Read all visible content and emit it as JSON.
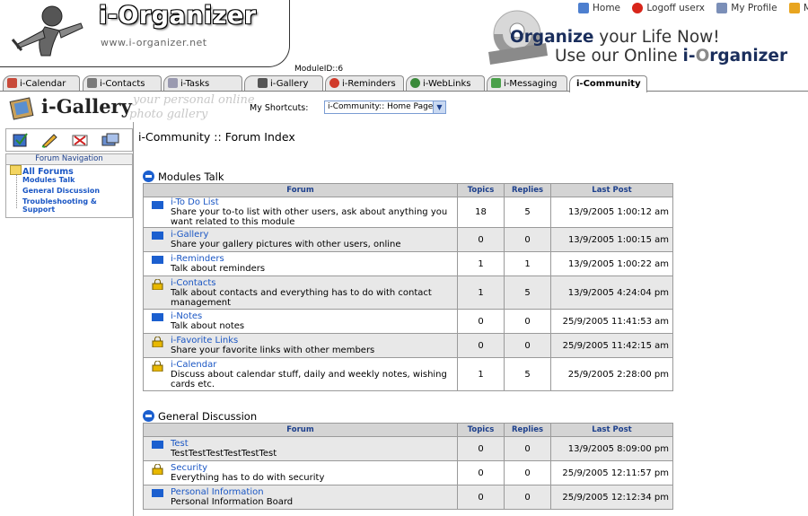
{
  "header": {
    "app_title": "i-Organizer",
    "app_url": "www.i-organizer.net",
    "module_id": "ModuleID::6",
    "top_links": [
      {
        "label": "Home",
        "icon": "home-icon"
      },
      {
        "label": "Logoff userx",
        "icon": "logoff-icon"
      },
      {
        "label": "My Profile",
        "icon": "profile-icon"
      },
      {
        "label": "My",
        "icon": "folder-icon"
      }
    ],
    "tagline_bold": "Organize",
    "tagline_rest": " your Life Now!",
    "tagline2_start": "Use our Online ",
    "tagline2_i": "i-",
    "tagline2_org": "O",
    "tagline2_end": "rganizer"
  },
  "tabs": [
    {
      "label": "i-Calendar",
      "active": false
    },
    {
      "label": "i-Contacts",
      "active": false
    },
    {
      "label": "i-Tasks",
      "active": false
    },
    {
      "label": "i-Gallery",
      "active": false
    },
    {
      "label": "i-Reminders",
      "active": false
    },
    {
      "label": "i-WebLinks",
      "active": false
    },
    {
      "label": "i-Messaging",
      "active": false
    },
    {
      "label": "i-Community",
      "active": true
    }
  ],
  "subheader": {
    "title": "i-Gallery",
    "subtitle_line1": "your personal online",
    "subtitle_line2": "photo gallery",
    "shortcuts_label": "My Shortcuts:",
    "shortcuts_value": "i-Community:: Home Page"
  },
  "sidebar": {
    "nav_title": "Forum Navigation",
    "all_forums": "All Forums",
    "items": [
      "Modules Talk",
      "General Discussion",
      "Troubleshooting &",
      "Support"
    ]
  },
  "main": {
    "breadcrumb": "i-Community :: Forum Index",
    "columns": {
      "forum": "Forum",
      "topics": "Topics",
      "replies": "Replies",
      "last_post": "Last Post"
    },
    "sections": [
      {
        "title": "Modules Talk",
        "rows": [
          {
            "name": "i-To Do List",
            "desc": "Share your to-to list with other users, ask about anything you want related to this module",
            "topics": "18",
            "replies": "5",
            "last_post": "13/9/2005 1:00:12 am",
            "locked": false
          },
          {
            "name": "i-Gallery",
            "desc": "Share your gallery pictures with other users, online",
            "topics": "0",
            "replies": "0",
            "last_post": "13/9/2005 1:00:15 am",
            "locked": false
          },
          {
            "name": "i-Reminders",
            "desc": "Talk about reminders",
            "topics": "1",
            "replies": "1",
            "last_post": "13/9/2005 1:00:22 am",
            "locked": false
          },
          {
            "name": "i-Contacts",
            "desc": "Talk about contacts and everything has to do with contact management",
            "topics": "1",
            "replies": "5",
            "last_post": "13/9/2005 4:24:04 pm",
            "locked": true
          },
          {
            "name": "i-Notes",
            "desc": "Talk about notes",
            "topics": "0",
            "replies": "0",
            "last_post": "25/9/2005 11:41:53 am",
            "locked": false
          },
          {
            "name": "i-Favorite Links",
            "desc": "Share your favorite links with other members",
            "topics": "0",
            "replies": "0",
            "last_post": "25/9/2005 11:42:15 am",
            "locked": true
          },
          {
            "name": "i-Calendar",
            "desc": "Discuss about calendar stuff, daily and weekly notes, wishing cards etc.",
            "topics": "1",
            "replies": "5",
            "last_post": "25/9/2005 2:28:00 pm",
            "locked": true
          }
        ]
      },
      {
        "title": "General Discussion",
        "rows": [
          {
            "name": "Test",
            "desc": "TestTestTestTestTestTest",
            "topics": "0",
            "replies": "0",
            "last_post": "13/9/2005 8:09:00 pm",
            "locked": false
          },
          {
            "name": "Security",
            "desc": "Everything has to do with security",
            "topics": "0",
            "replies": "0",
            "last_post": "25/9/2005 12:11:57 pm",
            "locked": true
          },
          {
            "name": "Personal Information",
            "desc": "Personal Information Board",
            "topics": "0",
            "replies": "0",
            "last_post": "25/9/2005 12:12:34 pm",
            "locked": false
          }
        ]
      }
    ]
  },
  "colors": {
    "link": "#1a56c4",
    "header_text": "#1c3f8c",
    "row_alt": "#e8e8e8",
    "section_icon": "#1b5fcf",
    "lock": "#e8b800"
  }
}
